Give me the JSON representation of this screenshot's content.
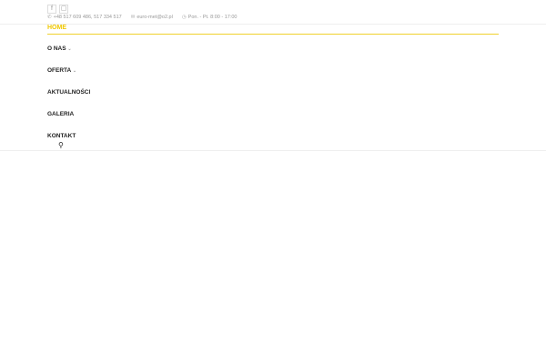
{
  "topbar": {
    "social": [
      "f",
      "▢"
    ],
    "phone": "+48 517 609 486, 517 334 517",
    "email": "euro-met@o2.pl",
    "hours": "Pon. - Pt. 8:00 - 17:00"
  },
  "nav": {
    "items": [
      {
        "label": "HOME"
      },
      {
        "label": "O NAS",
        "dropdown": "⌄"
      },
      {
        "label": "OFERTA",
        "dropdown": "⌄"
      },
      {
        "label": "AKTUALNOŚCI"
      },
      {
        "label": "GALERIA"
      },
      {
        "label": "KONTAKT"
      }
    ],
    "accent": "#f0c800"
  }
}
